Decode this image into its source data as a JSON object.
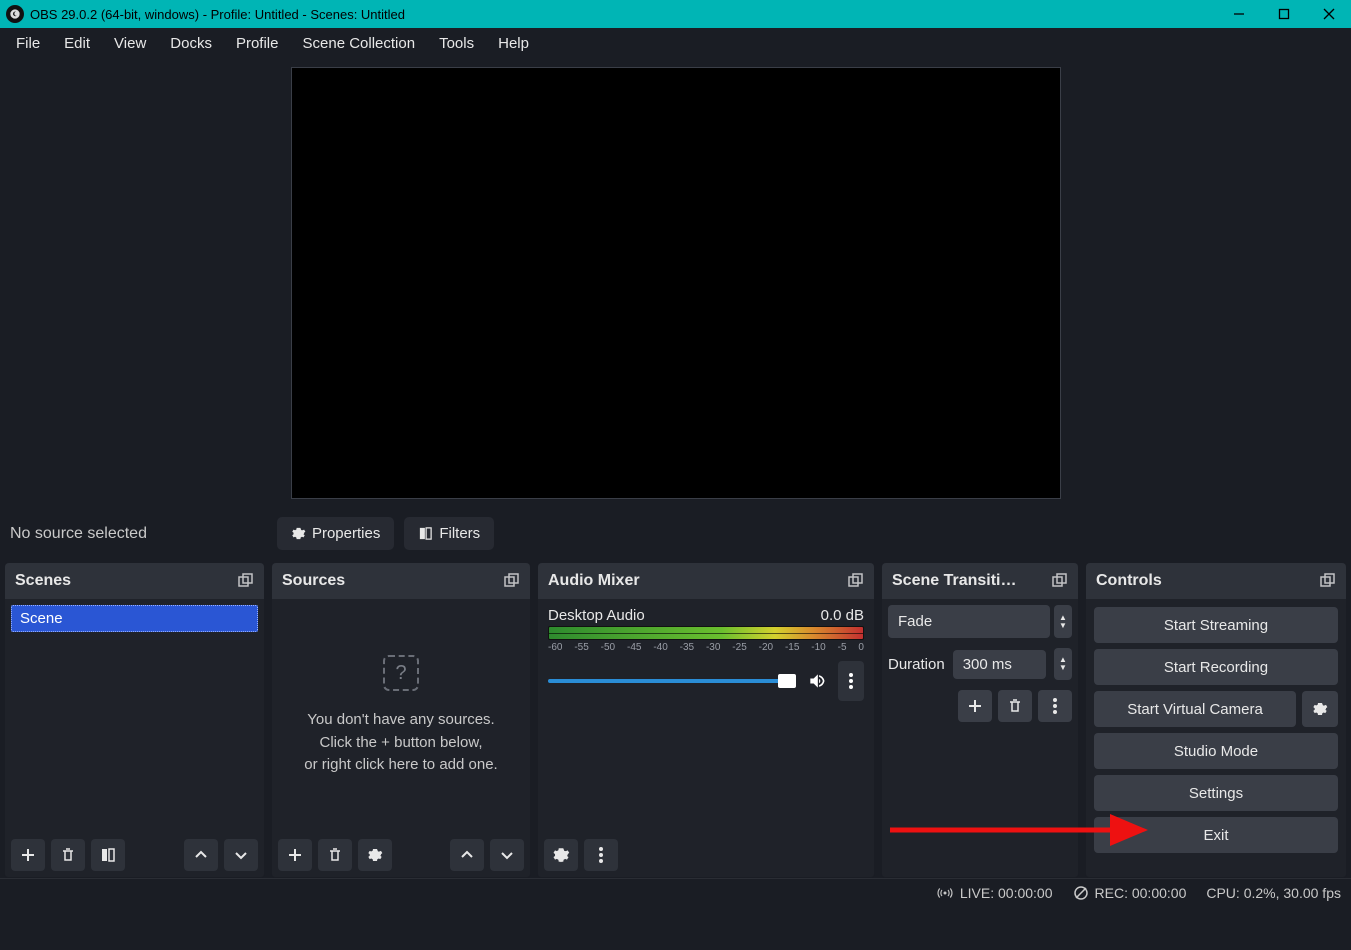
{
  "window": {
    "title": "OBS 29.0.2 (64-bit, windows) - Profile: Untitled - Scenes: Untitled"
  },
  "menu": [
    "File",
    "Edit",
    "View",
    "Docks",
    "Profile",
    "Scene Collection",
    "Tools",
    "Help"
  ],
  "toolbar": {
    "no_source": "No source selected",
    "properties": "Properties",
    "filters": "Filters"
  },
  "docks": {
    "scenes": {
      "title": "Scenes",
      "items": [
        "Scene"
      ]
    },
    "sources": {
      "title": "Sources",
      "empty_line1": "You don't have any sources.",
      "empty_line2": "Click the + button below,",
      "empty_line3": "or right click here to add one."
    },
    "audio": {
      "title": "Audio Mixer",
      "track_name": "Desktop Audio",
      "track_db": "0.0 dB",
      "ticks": [
        "-60",
        "-55",
        "-50",
        "-45",
        "-40",
        "-35",
        "-30",
        "-25",
        "-20",
        "-15",
        "-10",
        "-5",
        "0"
      ]
    },
    "transitions": {
      "title": "Scene Transiti…",
      "selected": "Fade",
      "duration_label": "Duration",
      "duration_value": "300 ms"
    },
    "controls": {
      "title": "Controls",
      "buttons": {
        "stream": "Start Streaming",
        "record": "Start Recording",
        "vcam": "Start Virtual Camera",
        "studio": "Studio Mode",
        "settings": "Settings",
        "exit": "Exit"
      }
    }
  },
  "status": {
    "live": "LIVE: 00:00:00",
    "rec": "REC: 00:00:00",
    "cpu": "CPU: 0.2%, 30.00 fps"
  }
}
